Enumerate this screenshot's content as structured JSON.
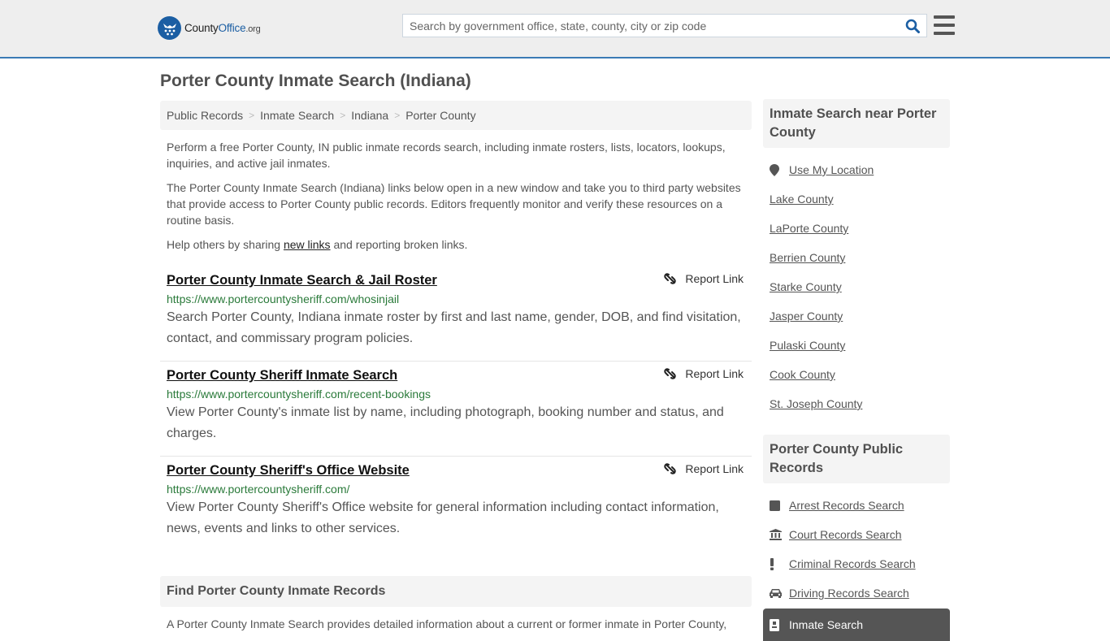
{
  "header": {
    "logo": {
      "name_part1": "County",
      "name_part2": "Office",
      "name_suffix": ".org"
    },
    "search": {
      "placeholder": "Search by government office, state, county, city or zip code",
      "value": ""
    },
    "icons": {
      "search": "search-icon",
      "menu": "hamburger-menu-icon"
    },
    "accent_color": "#3a7ab5"
  },
  "page": {
    "title": "Porter County Inmate Search (Indiana)"
  },
  "breadcrumb": [
    {
      "label": "Public Records"
    },
    {
      "label": "Inmate Search"
    },
    {
      "label": "Indiana"
    },
    {
      "label": "Porter County"
    }
  ],
  "intro": {
    "p1": "Perform a free Porter County, IN public inmate records search, including inmate rosters, lists, locators, lookups, inquiries, and active jail inmates.",
    "p2": "The Porter County Inmate Search (Indiana) links below open in a new window and take you to third party websites that provide access to Porter County public records. Editors frequently monitor and verify these resources on a routine basis.",
    "p3_before": "Help others by sharing ",
    "p3_link": "new links",
    "p3_after": " and reporting broken links."
  },
  "results": [
    {
      "title": "Porter County Inmate Search & Jail Roster",
      "url": "https://www.portercountysheriff.com/whosinjail",
      "description": "Search Porter County, Indiana inmate roster by first and last name, gender, DOB, and find visitation, contact, and commissary program policies.",
      "report_label": "Report Link"
    },
    {
      "title": "Porter County Sheriff Inmate Search",
      "url": "https://www.portercountysheriff.com/recent-bookings",
      "description": "View Porter County's inmate list by name, including photograph, booking number and status, and charges.",
      "report_label": "Report Link"
    },
    {
      "title": "Porter County Sheriff's Office Website",
      "url": "https://www.portercountysheriff.com/",
      "description": "View Porter County Sheriff's Office website for general information including contact information, news, events and links to other services.",
      "report_label": "Report Link"
    }
  ],
  "find_section": {
    "heading": "Find Porter County Inmate Records",
    "text": "A Porter County Inmate Search provides detailed information about a current or former inmate in Porter County,"
  },
  "sidebar": {
    "nearby": {
      "heading": "Inmate Search near Porter County",
      "use_location": "Use My Location",
      "items": [
        {
          "label": "Lake County"
        },
        {
          "label": "LaPorte County"
        },
        {
          "label": "Berrien County"
        },
        {
          "label": "Starke County"
        },
        {
          "label": "Jasper County"
        },
        {
          "label": "Pulaski County"
        },
        {
          "label": "Cook County"
        },
        {
          "label": "St. Joseph County"
        }
      ]
    },
    "public_records": {
      "heading": "Porter County Public Records",
      "items": [
        {
          "label": "Arrest Records Search",
          "icon": "square-icon"
        },
        {
          "label": "Court Records Search",
          "icon": "courthouse-icon"
        },
        {
          "label": "Criminal Records Search",
          "icon": "exclamation-icon"
        },
        {
          "label": "Driving Records Search",
          "icon": "car-icon"
        }
      ],
      "active": {
        "label": "Inmate Search",
        "icon": "id-badge-icon"
      }
    }
  }
}
